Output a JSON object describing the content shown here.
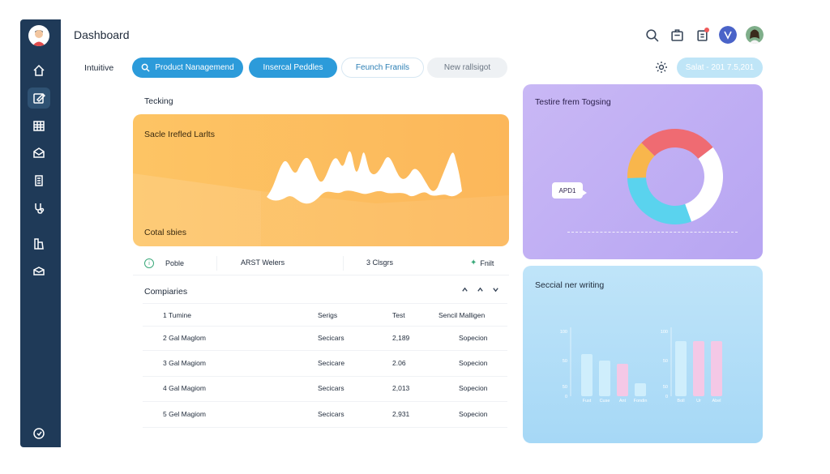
{
  "header": {
    "title": "Dashboard"
  },
  "filters": {
    "label": "Intuitive",
    "pills": [
      "Product Nanagemend",
      "Insercal Peddles",
      "Feunch Franils",
      "New rallsigot"
    ],
    "status": "Salat - 201 7.5,201"
  },
  "tracking": {
    "title": "Tecking",
    "card_title": "Sacle Irefled Larlts",
    "card_footer": "Cotal sbies"
  },
  "metrics": [
    {
      "label": "Poble"
    },
    {
      "label": "ARST Welers"
    },
    {
      "label": "3 Clsgrs"
    },
    {
      "label": "Fnilt"
    }
  ],
  "companies": {
    "title": "Compiaries",
    "columns": [
      "1 Tumine",
      "Serigs",
      "Test",
      "Sencil Malligen"
    ],
    "rows": [
      {
        "name": "2 Gal Maglom",
        "seg": "Secicars",
        "val": "2,189",
        "status": "Sopecion"
      },
      {
        "name": "3 Gal Magiom",
        "seg": "Secicare",
        "val": "2.06",
        "status": "Sopecion"
      },
      {
        "name": "4 Gal Magiom",
        "seg": "Secicars",
        "val": "2,013",
        "status": "Sopecion"
      },
      {
        "name": "5 Gel Magiom",
        "seg": "Secicars",
        "val": "2,931",
        "status": "Sopecion"
      }
    ]
  },
  "donut_card": {
    "title": "Testire frem Togsing",
    "tooltip": "APD1",
    "slices": [
      {
        "value": 27,
        "color": "#ef6b72"
      },
      {
        "value": 30,
        "color": "#ffffff"
      },
      {
        "value": 30,
        "color": "#5ad3ee"
      },
      {
        "value": 13,
        "color": "#f8b64c"
      }
    ]
  },
  "bar_card": {
    "title": "Seccial ner writing",
    "y_ticks_left": [
      "100",
      "50",
      "50",
      "0"
    ],
    "y_ticks_right": [
      "100",
      "50",
      "50",
      "0"
    ],
    "left_group": [
      {
        "label": "Fust",
        "value": 65,
        "color": "#cfeefc"
      },
      {
        "label": "Cuse",
        "value": 55,
        "color": "#cfeefc"
      },
      {
        "label": "Ant",
        "value": 50,
        "color": "#f4c8e6"
      },
      {
        "label": "Fondin",
        "value": 20,
        "color": "#cfeefc"
      }
    ],
    "right_group": [
      {
        "label": "Boll",
        "value": 85,
        "color": "#cfeefc"
      },
      {
        "label": "Ur",
        "value": 85,
        "color": "#f4c8e6"
      },
      {
        "label": "Abel",
        "value": 85,
        "color": "#f4c8e6"
      }
    ]
  }
}
